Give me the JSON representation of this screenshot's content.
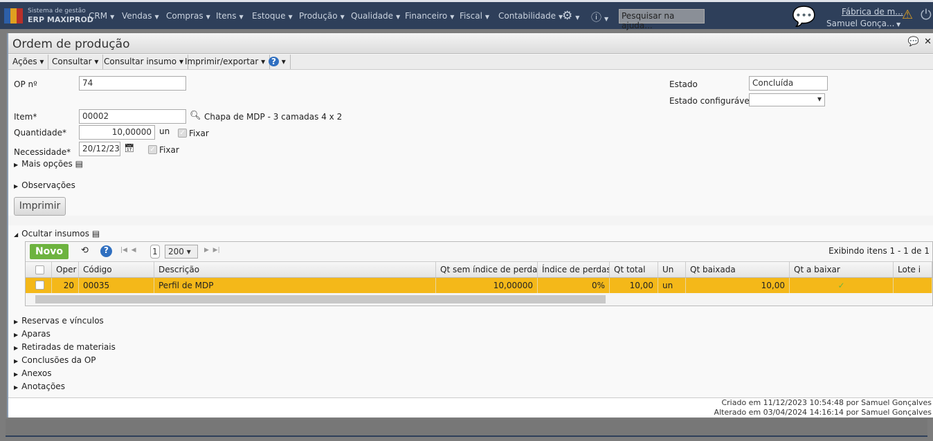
{
  "app": {
    "brand_line1": "Sistema de gestão",
    "brand_line2": "ERP MAXIPROD",
    "search_placeholder": "Pesquisar na ajuda...",
    "company": "Fábrica de m...",
    "user": "Samuel Gonça...",
    "menu": [
      "CRM",
      "Vendas",
      "Compras",
      "Itens",
      "Estoque",
      "Produção",
      "Qualidade",
      "Financeiro",
      "Fiscal",
      "Contabilidade"
    ]
  },
  "window": {
    "title": "Ordem de produção",
    "toolbar": [
      "Ações",
      "Consultar",
      "Consultar insumo",
      "Imprimir/exportar"
    ]
  },
  "form": {
    "op_label": "OP nº",
    "op_value": "74",
    "item_label": "Item*",
    "item_value": "00002",
    "item_desc": "Chapa de MDP - 3 camadas 4 x 2",
    "qty_label": "Quantidade*",
    "qty_value": "10,00000",
    "qty_unit": "un",
    "fixar": "Fixar",
    "nec_label": "Necessidade*",
    "nec_value": "20/12/23",
    "estado_label": "Estado",
    "estado_value": "Concluída",
    "estado_conf_label": "Estado configurável",
    "estado_conf_value": "",
    "mais_opcoes": "Mais opções",
    "observacoes": "Observações",
    "imprimir": "Imprimir",
    "ocultar_insumos": "Ocultar insumos"
  },
  "grid": {
    "novo": "Novo",
    "page": "1",
    "page_size": "200",
    "showing": "Exibindo itens 1 - 1 de 1",
    "columns": [
      "Oper",
      "Código",
      "Descrição",
      "Qt sem índice de perdas",
      "Índice de perdas",
      "Qt total",
      "Un",
      "Qt baixada",
      "Qt a baixar",
      "Lote i"
    ],
    "rows": [
      [
        "20",
        "00035",
        "Perfil de MDP",
        "10,00000",
        "0%",
        "10,00",
        "un",
        "10,00",
        "✓",
        ""
      ]
    ]
  },
  "sections": [
    "Reservas e vínculos",
    "Aparas",
    "Retiradas de materiais",
    "Conclusões da OP",
    "Anexos",
    "Anotações"
  ],
  "footer": {
    "created": "Criado em 11/12/2023 10:54:48 por Samuel Gonçalves",
    "changed": "Alterado em 03/04/2024 14:16:14 por Samuel Gonçalves"
  },
  "colors": {
    "topbar": "#2e3f5a",
    "row_selected": "#f4b819",
    "novo": "#6db33f"
  }
}
